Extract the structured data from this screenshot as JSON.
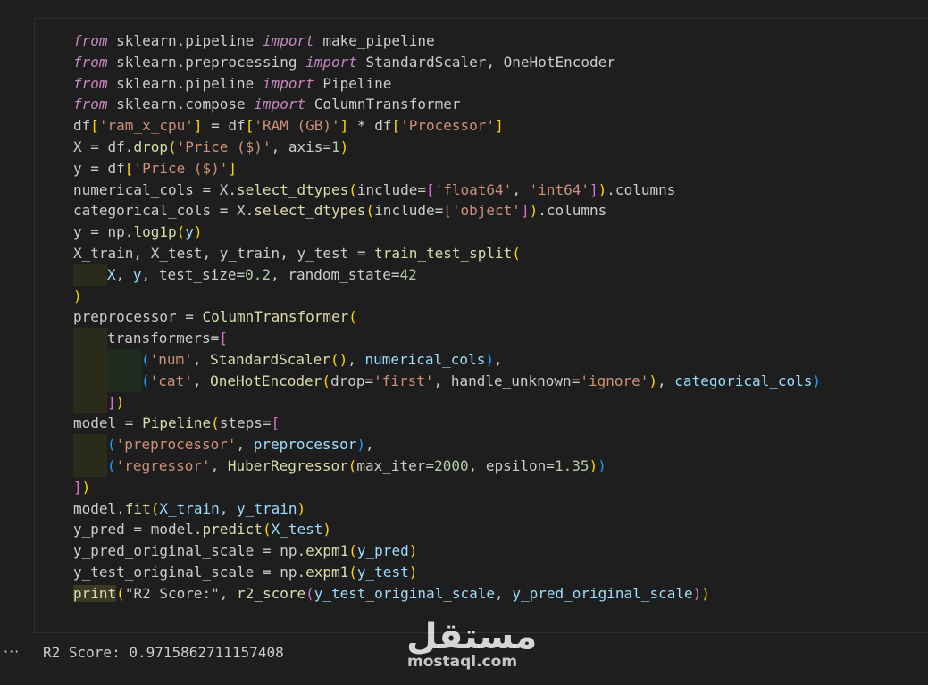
{
  "code_lines": [
    [
      {
        "t": "from",
        "c": "kw"
      },
      {
        "t": " sklearn.pipeline "
      },
      {
        "t": "import",
        "c": "kw"
      },
      {
        "t": " make_pipeline"
      }
    ],
    [
      {
        "t": "from",
        "c": "kw"
      },
      {
        "t": " sklearn.preprocessing "
      },
      {
        "t": "import",
        "c": "kw"
      },
      {
        "t": " StandardScaler, OneHotEncoder"
      }
    ],
    [
      {
        "t": "from",
        "c": "kw"
      },
      {
        "t": " sklearn.pipeline "
      },
      {
        "t": "import",
        "c": "kw"
      },
      {
        "t": " Pipeline"
      }
    ],
    [
      {
        "t": "from",
        "c": "kw"
      },
      {
        "t": " sklearn.compose "
      },
      {
        "t": "import",
        "c": "kw"
      },
      {
        "t": " ColumnTransformer"
      }
    ],
    [
      {
        "t": "df"
      },
      {
        "t": "[",
        "c": "b1"
      },
      {
        "t": "'ram_x_cpu'",
        "c": "str"
      },
      {
        "t": "]",
        "c": "b1"
      },
      {
        "t": " = df"
      },
      {
        "t": "[",
        "c": "b1"
      },
      {
        "t": "'RAM (GB)'",
        "c": "str"
      },
      {
        "t": "]",
        "c": "b1"
      },
      {
        "t": " * df"
      },
      {
        "t": "[",
        "c": "b1"
      },
      {
        "t": "'Processor'",
        "c": "str"
      },
      {
        "t": "]",
        "c": "b1"
      }
    ],
    [
      {
        "t": "X = df."
      },
      {
        "t": "drop",
        "c": "fn"
      },
      {
        "t": "(",
        "c": "b1"
      },
      {
        "t": "'Price ($)'",
        "c": "str"
      },
      {
        "t": ", axis="
      },
      {
        "t": "1",
        "c": "num"
      },
      {
        "t": ")",
        "c": "b1"
      }
    ],
    [
      {
        "t": "y = df"
      },
      {
        "t": "[",
        "c": "b1"
      },
      {
        "t": "'Price ($)'",
        "c": "str"
      },
      {
        "t": "]",
        "c": "b1"
      }
    ],
    [
      {
        "t": "numerical_cols = X."
      },
      {
        "t": "select_dtypes",
        "c": "fn"
      },
      {
        "t": "(",
        "c": "b1"
      },
      {
        "t": "include="
      },
      {
        "t": "[",
        "c": "b2"
      },
      {
        "t": "'float64'",
        "c": "str"
      },
      {
        "t": ", "
      },
      {
        "t": "'int64'",
        "c": "str"
      },
      {
        "t": "]",
        "c": "b2"
      },
      {
        "t": ")",
        "c": "b1"
      },
      {
        "t": ".columns"
      }
    ],
    [
      {
        "t": "categorical_cols = X."
      },
      {
        "t": "select_dtypes",
        "c": "fn"
      },
      {
        "t": "(",
        "c": "b1"
      },
      {
        "t": "include="
      },
      {
        "t": "[",
        "c": "b2"
      },
      {
        "t": "'object'",
        "c": "str"
      },
      {
        "t": "]",
        "c": "b2"
      },
      {
        "t": ")",
        "c": "b1"
      },
      {
        "t": ".columns"
      }
    ],
    [
      {
        "t": "y = np."
      },
      {
        "t": "log1p",
        "c": "fn"
      },
      {
        "t": "(",
        "c": "b1"
      },
      {
        "t": "y",
        "c": "var"
      },
      {
        "t": ")",
        "c": "b1"
      }
    ],
    [
      {
        "t": "X_train, X_test, y_train, y_test = "
      },
      {
        "t": "train_test_split",
        "c": "fn"
      },
      {
        "t": "(",
        "c": "b1"
      }
    ],
    [
      {
        "ig": "y"
      },
      {
        "t": "X",
        "c": "var"
      },
      {
        "t": ", "
      },
      {
        "t": "y",
        "c": "var"
      },
      {
        "t": ", test_size="
      },
      {
        "t": "0.2",
        "c": "num"
      },
      {
        "t": ", random_state="
      },
      {
        "t": "42",
        "c": "num"
      }
    ],
    [
      {
        "t": ")",
        "c": "b1"
      }
    ],
    [
      {
        "t": "preprocessor = "
      },
      {
        "t": "ColumnTransformer",
        "c": "fn"
      },
      {
        "t": "(",
        "c": "b1"
      }
    ],
    [
      {
        "ig": "y"
      },
      {
        "t": "transformers="
      },
      {
        "t": "[",
        "c": "b2"
      }
    ],
    [
      {
        "ig": "y"
      },
      {
        "ig": "g"
      },
      {
        "t": "(",
        "c": "b3"
      },
      {
        "t": "'num'",
        "c": "str"
      },
      {
        "t": ", "
      },
      {
        "t": "StandardScaler",
        "c": "fn"
      },
      {
        "t": "()",
        "c": "b1"
      },
      {
        "t": ", "
      },
      {
        "t": "numerical_cols",
        "c": "var"
      },
      {
        "t": ")",
        "c": "b3"
      },
      {
        "t": ","
      }
    ],
    [
      {
        "ig": "y"
      },
      {
        "ig": "g"
      },
      {
        "t": "(",
        "c": "b3"
      },
      {
        "t": "'cat'",
        "c": "str"
      },
      {
        "t": ", "
      },
      {
        "t": "OneHotEncoder",
        "c": "fn"
      },
      {
        "t": "(",
        "c": "b1"
      },
      {
        "t": "drop="
      },
      {
        "t": "'first'",
        "c": "str"
      },
      {
        "t": ", handle_unknown="
      },
      {
        "t": "'ignore'",
        "c": "str"
      },
      {
        "t": ")",
        "c": "b1"
      },
      {
        "t": ", "
      },
      {
        "t": "categorical_cols",
        "c": "var"
      },
      {
        "t": ")",
        "c": "b3"
      }
    ],
    [
      {
        "ig": "y"
      },
      {
        "t": "]",
        "c": "b2"
      },
      {
        "t": ")",
        "c": "b1"
      }
    ],
    [
      {
        "t": "model = "
      },
      {
        "t": "Pipeline",
        "c": "fn"
      },
      {
        "t": "(",
        "c": "b1"
      },
      {
        "t": "steps="
      },
      {
        "t": "[",
        "c": "b2"
      }
    ],
    [
      {
        "ig": "y"
      },
      {
        "t": "(",
        "c": "b3"
      },
      {
        "t": "'preprocessor'",
        "c": "str"
      },
      {
        "t": ", "
      },
      {
        "t": "preprocessor",
        "c": "var"
      },
      {
        "t": ")",
        "c": "b3"
      },
      {
        "t": ","
      }
    ],
    [
      {
        "ig": "y"
      },
      {
        "t": "(",
        "c": "b3"
      },
      {
        "t": "'regressor'",
        "c": "str"
      },
      {
        "t": ", "
      },
      {
        "t": "HuberRegressor",
        "c": "fn"
      },
      {
        "t": "(",
        "c": "b1"
      },
      {
        "t": "max_iter="
      },
      {
        "t": "2000",
        "c": "num"
      },
      {
        "t": ", epsilon="
      },
      {
        "t": "1.35",
        "c": "num"
      },
      {
        "t": ")",
        "c": "b1"
      },
      {
        "t": ")",
        "c": "b3"
      }
    ],
    [
      {
        "t": "]",
        "c": "b2"
      },
      {
        "t": ")",
        "c": "b1"
      }
    ],
    [
      {
        "t": "model."
      },
      {
        "t": "fit",
        "c": "fn"
      },
      {
        "t": "(",
        "c": "b1"
      },
      {
        "t": "X_train",
        "c": "var"
      },
      {
        "t": ", "
      },
      {
        "t": "y_train",
        "c": "var"
      },
      {
        "t": ")",
        "c": "b1"
      }
    ],
    [
      {
        "t": "y_pred = model."
      },
      {
        "t": "predict",
        "c": "fn"
      },
      {
        "t": "(",
        "c": "b1"
      },
      {
        "t": "X_test",
        "c": "var"
      },
      {
        "t": ")",
        "c": "b1"
      }
    ],
    [
      {
        "t": "y_pred_original_scale = np."
      },
      {
        "t": "expm1",
        "c": "fn"
      },
      {
        "t": "(",
        "c": "b1"
      },
      {
        "t": "y_pred",
        "c": "var"
      },
      {
        "t": ")",
        "c": "b1"
      }
    ],
    [
      {
        "t": "y_test_original_scale = np."
      },
      {
        "t": "expm1",
        "c": "fn"
      },
      {
        "t": "(",
        "c": "b1"
      },
      {
        "t": "y_test",
        "c": "var"
      },
      {
        "t": ")",
        "c": "b1"
      }
    ],
    [
      {
        "t": "print",
        "c": "pr"
      },
      {
        "t": "(",
        "c": "b1"
      },
      {
        "t": "\"R2 Score:\", "
      },
      {
        "t": "r2_score",
        "c": "fn"
      },
      {
        "t": "(",
        "c": "b2"
      },
      {
        "t": "y_test_original_scale",
        "c": "var"
      },
      {
        "t": ", "
      },
      {
        "t": "y_pred_original_scale",
        "c": "var"
      },
      {
        "t": ")",
        "c": "b2"
      },
      {
        "t": ")",
        "c": "b1"
      }
    ]
  ],
  "output": {
    "more_label": "···",
    "text": "R2 Score: 0.9715862711157408"
  },
  "watermark": {
    "arabic": "مستقل",
    "url": "mostaql.com"
  }
}
